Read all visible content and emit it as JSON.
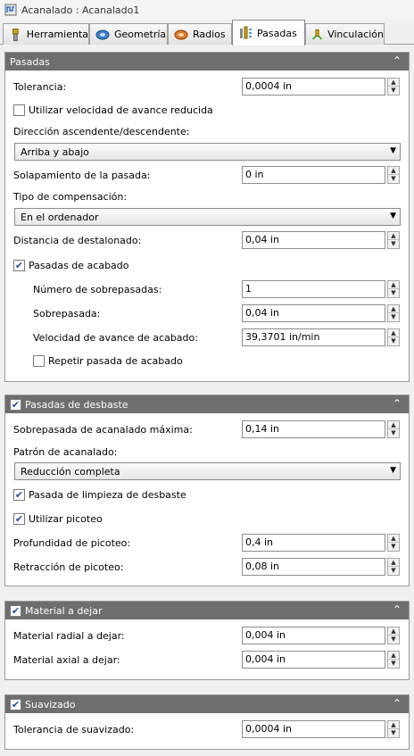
{
  "window": {
    "title": "Acanalado : Acanalado1",
    "title_icon": "groove-op-icon"
  },
  "tabs": [
    {
      "label": "Herramienta",
      "icon": "tool-icon",
      "active": false
    },
    {
      "label": "Geometría",
      "icon": "geometry-icon",
      "active": false
    },
    {
      "label": "Radios",
      "icon": "radii-icon",
      "active": false
    },
    {
      "label": "Pasadas",
      "icon": "passes-icon",
      "active": true
    },
    {
      "label": "Vinculación",
      "icon": "linking-icon",
      "active": false
    }
  ],
  "pasadas": {
    "header": "Pasadas",
    "tolerancia_label": "Tolerancia:",
    "tolerancia_value": "0,0004 in",
    "vel_reducida_label": "Utilizar velocidad de avance reducida",
    "vel_reducida_checked": false,
    "direccion_label": "Dirección ascendente/descendente:",
    "direccion_value": "Arriba y abajo",
    "solapamiento_label": "Solapamiento de la pasada:",
    "solapamiento_value": "0 in",
    "compensacion_label": "Tipo de compensación:",
    "compensacion_value": "En el ordenador",
    "destalonado_label": "Distancia de destalonado:",
    "destalonado_value": "0,04 in",
    "acabado_label": "Pasadas de acabado",
    "acabado_checked": true,
    "num_sobrepasadas_label": "Número de sobrepasadas:",
    "num_sobrepasadas_value": "1",
    "sobrepasada_label": "Sobrepasada:",
    "sobrepasada_value": "0,04 in",
    "vel_acabado_label": "Velocidad de avance de acabado:",
    "vel_acabado_value": "39,3701 in/min",
    "repetir_label": "Repetir pasada de acabado",
    "repetir_checked": false
  },
  "desbaste": {
    "header": "Pasadas de desbaste",
    "header_checked": true,
    "sobrepasada_max_label": "Sobrepasada de acanalado máxima:",
    "sobrepasada_max_value": "0,14 in",
    "patron_label": "Patrón de acanalado:",
    "patron_value": "Reducción completa",
    "limpieza_label": "Pasada de limpieza de desbaste",
    "limpieza_checked": true,
    "picoteo_label": "Utilizar picoteo",
    "picoteo_checked": true,
    "prof_picoteo_label": "Profundidad de picoteo:",
    "prof_picoteo_value": "0,4 in",
    "retraccion_label": "Retracción de picoteo:",
    "retraccion_value": "0,08 in"
  },
  "material": {
    "header": "Material a dejar",
    "header_checked": true,
    "radial_label": "Material radial a dejar:",
    "radial_value": "0,004 in",
    "axial_label": "Material axial a dejar:",
    "axial_value": "0,004 in"
  },
  "suavizado": {
    "header": "Suavizado",
    "header_checked": true,
    "tolerancia_label": "Tolerancia de suavizado:",
    "tolerancia_value": "0,0004 in"
  },
  "colors": {
    "panel_header": "#6e6e6e",
    "check": "#1f4f9a"
  }
}
